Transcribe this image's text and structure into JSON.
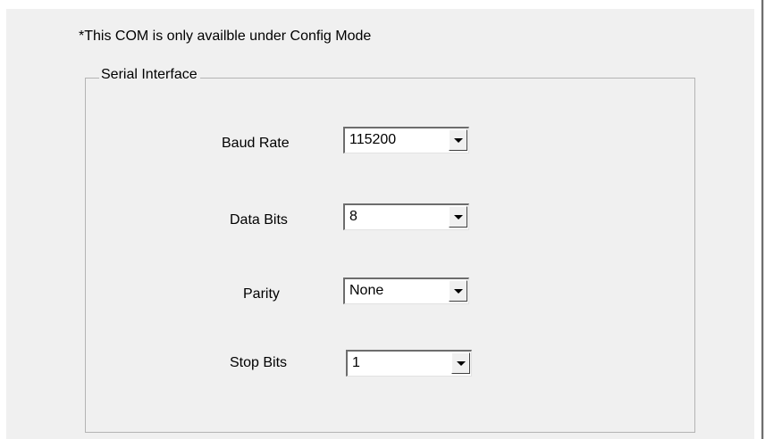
{
  "note": "*This COM is only availble under Config Mode",
  "serial_interface": {
    "title": "Serial Interface",
    "fields": [
      {
        "label": "Baud Rate",
        "value": "115200",
        "icon": "chevron-down-icon"
      },
      {
        "label": "Data Bits",
        "value": "8",
        "icon": "chevron-down-icon"
      },
      {
        "label": "Parity",
        "value": "None",
        "icon": "chevron-down-icon"
      },
      {
        "label": "Stop Bits",
        "value": "1",
        "icon": "chevron-down-icon"
      }
    ]
  }
}
